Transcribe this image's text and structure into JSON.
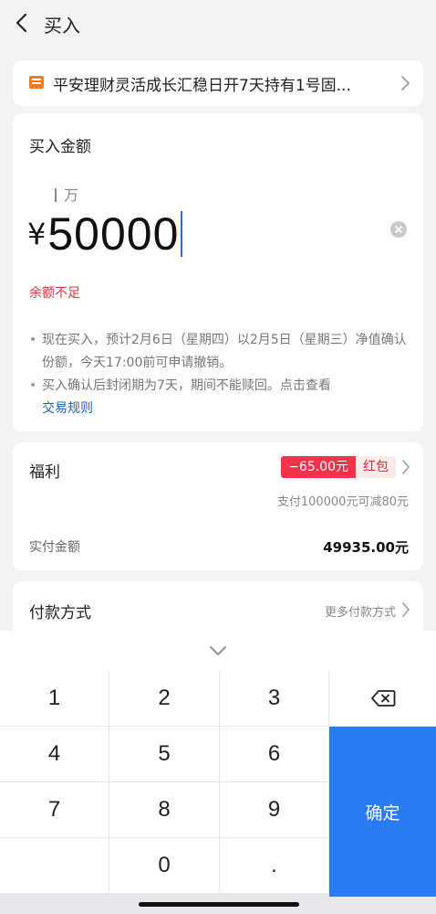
{
  "header": {
    "title": "买入"
  },
  "product": {
    "name": "平安理财灵活成长汇稳日开7天持有1号固..."
  },
  "amount": {
    "title": "买入金额",
    "unit_hint": "万",
    "currency": "¥",
    "value": "50000",
    "warning": "余额不足",
    "notes": [
      "现在买入，预计2月6日（星期四）以2月5日（星期三）净值确认份额，今天17:00前可申请撤销。",
      "买入确认后封闭期为7天，期间不能赎回。点击查看"
    ],
    "rules_link": "交易规则"
  },
  "benefit": {
    "title": "福利",
    "redpack_amount": "−65.00元",
    "redpack_tag": "红包",
    "note": "支付100000元可减80元",
    "paid_label": "实付金额",
    "paid_value": "49935.00元"
  },
  "payment": {
    "title": "付款方式",
    "more_label": "更多付款方式"
  },
  "keyboard": {
    "keys": [
      "1",
      "2",
      "3",
      "4",
      "5",
      "6",
      "7",
      "8",
      "9",
      "0",
      "."
    ],
    "confirm_label": "确定"
  },
  "colors": {
    "accent": "#2a7bf6",
    "warning": "#d9363e",
    "redpack": "#f2344a",
    "link": "#1f5fbf"
  }
}
